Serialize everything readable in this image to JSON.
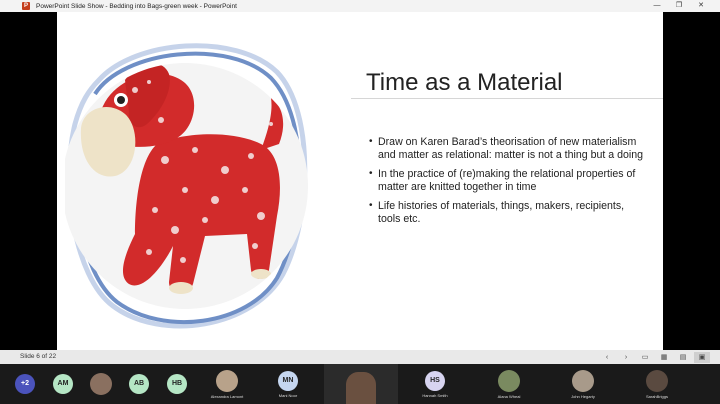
{
  "window": {
    "title": "PowerPoint Slide Show  -  Bedding into Bags-green week  -  PowerPoint",
    "app_icon": "P",
    "controls": [
      "—",
      "❐",
      "✕"
    ]
  },
  "slide": {
    "title": "Time as a Material",
    "bullets": [
      "Draw on Karen Barad’s theorisation of new materialism and matter as relational: matter is not a thing but a doing",
      "In the practice of (re)making the relational properties of matter are knitted together in time",
      "Life histories of materials, things, makers, recipients, tools etc."
    ],
    "image": "red floral fabric toy dog",
    "colors": {
      "ring": "#6f8fc6",
      "fabric": "#d22b2b"
    }
  },
  "showbar": {
    "counter": "Slide 6 of 22",
    "buttons": [
      "‹",
      "›",
      "▭",
      "▦",
      "▤",
      "▣"
    ]
  },
  "participants": {
    "overflow": "+2",
    "avatars": [
      {
        "initials": "AM",
        "color": "#b5e6c5"
      },
      {
        "initials": "AB",
        "color": "#b5e6c5"
      },
      {
        "initials": "HB",
        "color": "#b5e6c5"
      },
      {
        "initials": "MN",
        "color": "#c5d6f0"
      },
      {
        "initials": "HS",
        "color": "#d7d4f0"
      }
    ],
    "names": {
      "alexandra": "Alexandra Lamont",
      "mn": "Mani Noor",
      "hs": "Hannah Smith",
      "alana": "Alana Wheal",
      "john": "John Hegarty",
      "sarah": "SarahBriggs"
    }
  }
}
